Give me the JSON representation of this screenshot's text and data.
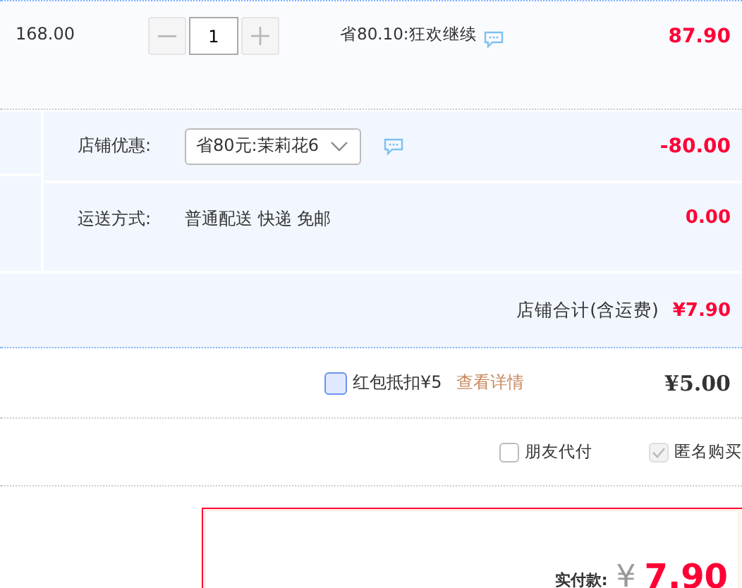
{
  "item": {
    "price": "168.00",
    "quantity": "1",
    "promo": "省80.10:狂欢继续",
    "subtotal": "87.90"
  },
  "store": {
    "discount": {
      "label": "店铺优惠:",
      "value": "省80元:茉莉花6",
      "amount": "-80.00"
    },
    "shipping": {
      "label": "运送方式:",
      "value": "普通配送 快递 免邮",
      "amount": "0.00"
    },
    "total": {
      "label": "店铺合计(含运费)",
      "amount": "¥7.90"
    }
  },
  "red_packet": {
    "checked": false,
    "focused": true,
    "label": "红包抵扣¥5",
    "link": "查看详情",
    "amount": "¥5.00"
  },
  "options": [
    {
      "label": "朋友代付",
      "checked": false,
      "disabled": false
    },
    {
      "label": "匿名购买",
      "checked": true,
      "disabled": true
    }
  ],
  "payment": {
    "label": "实付款:",
    "currency": "¥",
    "amount": "7.90"
  }
}
